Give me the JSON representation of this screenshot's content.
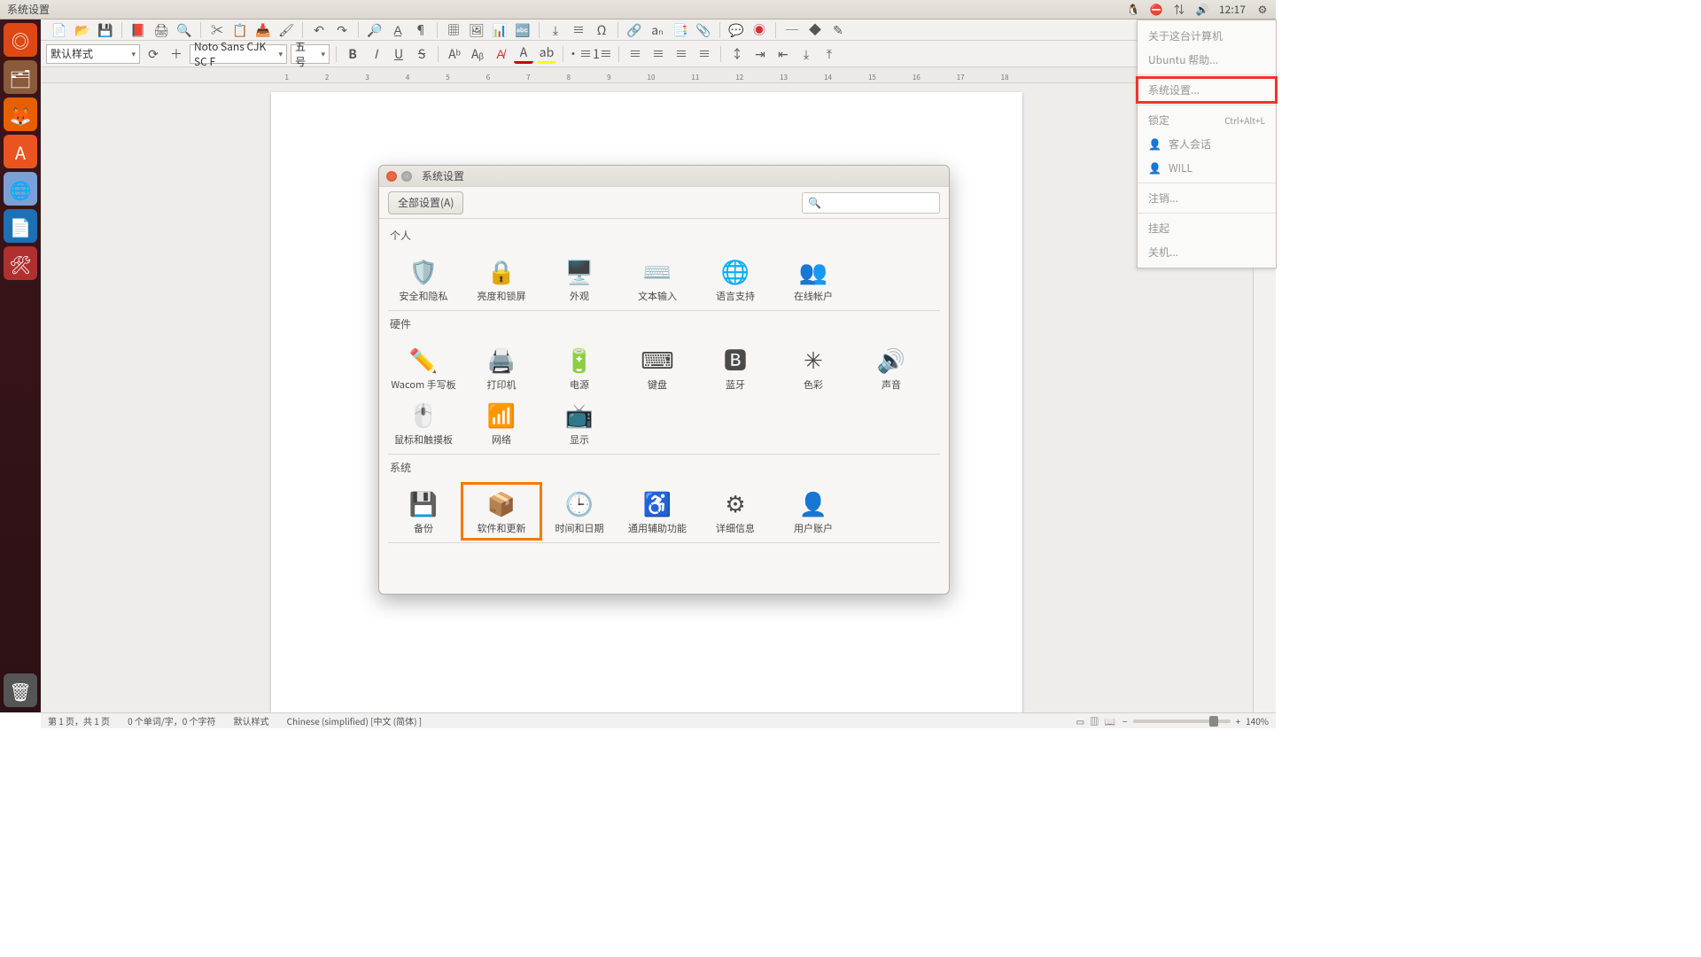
{
  "menubar": {
    "title": "系统设置",
    "time": "12:17"
  },
  "toolbar": {
    "style": "默认样式",
    "font": "Noto Sans CJK SC F",
    "size": "五号"
  },
  "ruler_nums": [
    "1",
    "2",
    "3",
    "4",
    "5",
    "6",
    "7",
    "8",
    "9",
    "10",
    "11",
    "12",
    "13",
    "14",
    "15",
    "16",
    "17",
    "18"
  ],
  "sysmenu": {
    "about": "关于这台计算机",
    "help": "Ubuntu 帮助...",
    "settings": "系统设置...",
    "lock": "锁定",
    "lock_shortcut": "Ctrl+Alt+L",
    "guest": "客人会话",
    "user": "WILL",
    "logout": "注销...",
    "suspend": "挂起",
    "shutdown": "关机..."
  },
  "dialog": {
    "title": "系统设置",
    "all": "全部设置(A)",
    "categories": [
      {
        "name": "个人",
        "items": [
          {
            "label": "安全和隐私",
            "icon": "🛡️"
          },
          {
            "label": "亮度和锁屏",
            "icon": "🔒"
          },
          {
            "label": "外观",
            "icon": "🖥️"
          },
          {
            "label": "文本输入",
            "icon": "⌨️"
          },
          {
            "label": "语言支持",
            "icon": "🌐"
          },
          {
            "label": "在线帐户",
            "icon": "👥"
          }
        ]
      },
      {
        "name": "硬件",
        "items": [
          {
            "label": "Wacom 手写板",
            "icon": "✏️"
          },
          {
            "label": "打印机",
            "icon": "🖨️"
          },
          {
            "label": "电源",
            "icon": "🔋"
          },
          {
            "label": "键盘",
            "icon": "⌨"
          },
          {
            "label": "蓝牙",
            "icon": "🅱"
          },
          {
            "label": "色彩",
            "icon": "✳"
          },
          {
            "label": "声音",
            "icon": "🔊"
          },
          {
            "label": "鼠标和触摸板",
            "icon": "🖱️"
          },
          {
            "label": "网络",
            "icon": "📶"
          },
          {
            "label": "显示",
            "icon": "📺"
          }
        ]
      },
      {
        "name": "系统",
        "items": [
          {
            "label": "备份",
            "icon": "💾"
          },
          {
            "label": "软件和更新",
            "icon": "📦",
            "hl": true
          },
          {
            "label": "时间和日期",
            "icon": "🕒"
          },
          {
            "label": "通用辅助功能",
            "icon": "♿"
          },
          {
            "label": "详细信息",
            "icon": "⚙"
          },
          {
            "label": "用户账户",
            "icon": "👤"
          }
        ]
      }
    ]
  },
  "status": {
    "page": "第 1 页，共 1 页",
    "words": "0 个单词/字，0 个字符",
    "style": "默认样式",
    "lang": "Chinese (simplified) [中文 (简体) ]",
    "zoom": "140%"
  }
}
